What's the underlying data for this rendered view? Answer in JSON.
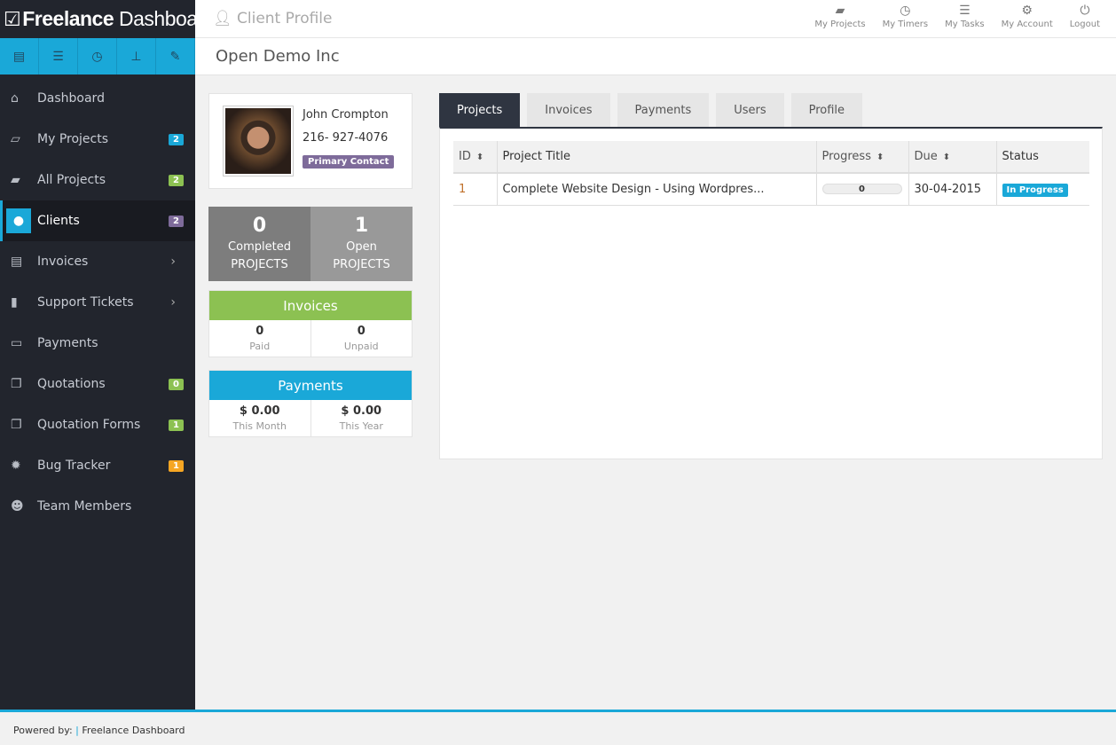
{
  "app": {
    "logo_bold": "Freelance",
    "logo_light": "Dashboard"
  },
  "header": {
    "title": "Client Profile",
    "links": [
      {
        "label": "My Projects",
        "icon": "folder-open-icon"
      },
      {
        "label": "My Timers",
        "icon": "clock-icon"
      },
      {
        "label": "My Tasks",
        "icon": "list-icon"
      },
      {
        "label": "My Account",
        "icon": "gears-icon"
      },
      {
        "label": "Logout",
        "icon": "power-icon"
      }
    ]
  },
  "page_title": "Open Demo Inc",
  "sidebar": {
    "items": [
      {
        "label": "Dashboard",
        "icon": "home-icon"
      },
      {
        "label": "My Projects",
        "icon": "folder-open-icon",
        "badge": "2",
        "badge_color": "#1aa8d8"
      },
      {
        "label": "All Projects",
        "icon": "folder-icon",
        "badge": "2",
        "badge_color": "#8cc152"
      },
      {
        "label": "Clients",
        "icon": "user-icon",
        "badge": "2",
        "badge_color": "#7e6b9a"
      },
      {
        "label": "Invoices",
        "icon": "invoice-icon"
      },
      {
        "label": "Support Tickets",
        "icon": "file-icon"
      },
      {
        "label": "Payments",
        "icon": "credit-card-icon"
      },
      {
        "label": "Quotations",
        "icon": "copy-icon",
        "badge": "0",
        "badge_color": "#8cc152"
      },
      {
        "label": "Quotation Forms",
        "icon": "copy-icon",
        "badge": "1",
        "badge_color": "#8cc152"
      },
      {
        "label": "Bug Tracker",
        "icon": "bug-icon",
        "badge": "1",
        "badge_color": "#f6a623"
      },
      {
        "label": "Team Members",
        "icon": "users-icon"
      }
    ]
  },
  "profile": {
    "name": "John Crompton",
    "phone": "216- 927-4076",
    "tag": "Primary Contact"
  },
  "stats": {
    "completed": "0",
    "completed_label": "Completed",
    "open": "1",
    "open_label": "Open",
    "projects_label": "PROJECTS"
  },
  "invoices": {
    "title": "Invoices",
    "paid": "0",
    "paid_label": "Paid",
    "unpaid": "0",
    "unpaid_label": "Unpaid"
  },
  "payments": {
    "title": "Payments",
    "month": "$ 0.00",
    "month_label": "This Month",
    "year": "$ 0.00",
    "year_label": "This Year"
  },
  "tabs": [
    "Projects",
    "Invoices",
    "Payments",
    "Users",
    "Profile"
  ],
  "table": {
    "headers": [
      "ID",
      "Project Title",
      "Progress",
      "Due",
      "Status"
    ],
    "rows": [
      {
        "id": "1",
        "title": "Complete Website Design - Using Wordpres...",
        "progress": "0",
        "due": "30-04-2015",
        "status": "In Progress"
      }
    ]
  },
  "footer": {
    "powered": "Powered by:",
    "sep": "|",
    "brand": "Freelance Dashboard"
  }
}
